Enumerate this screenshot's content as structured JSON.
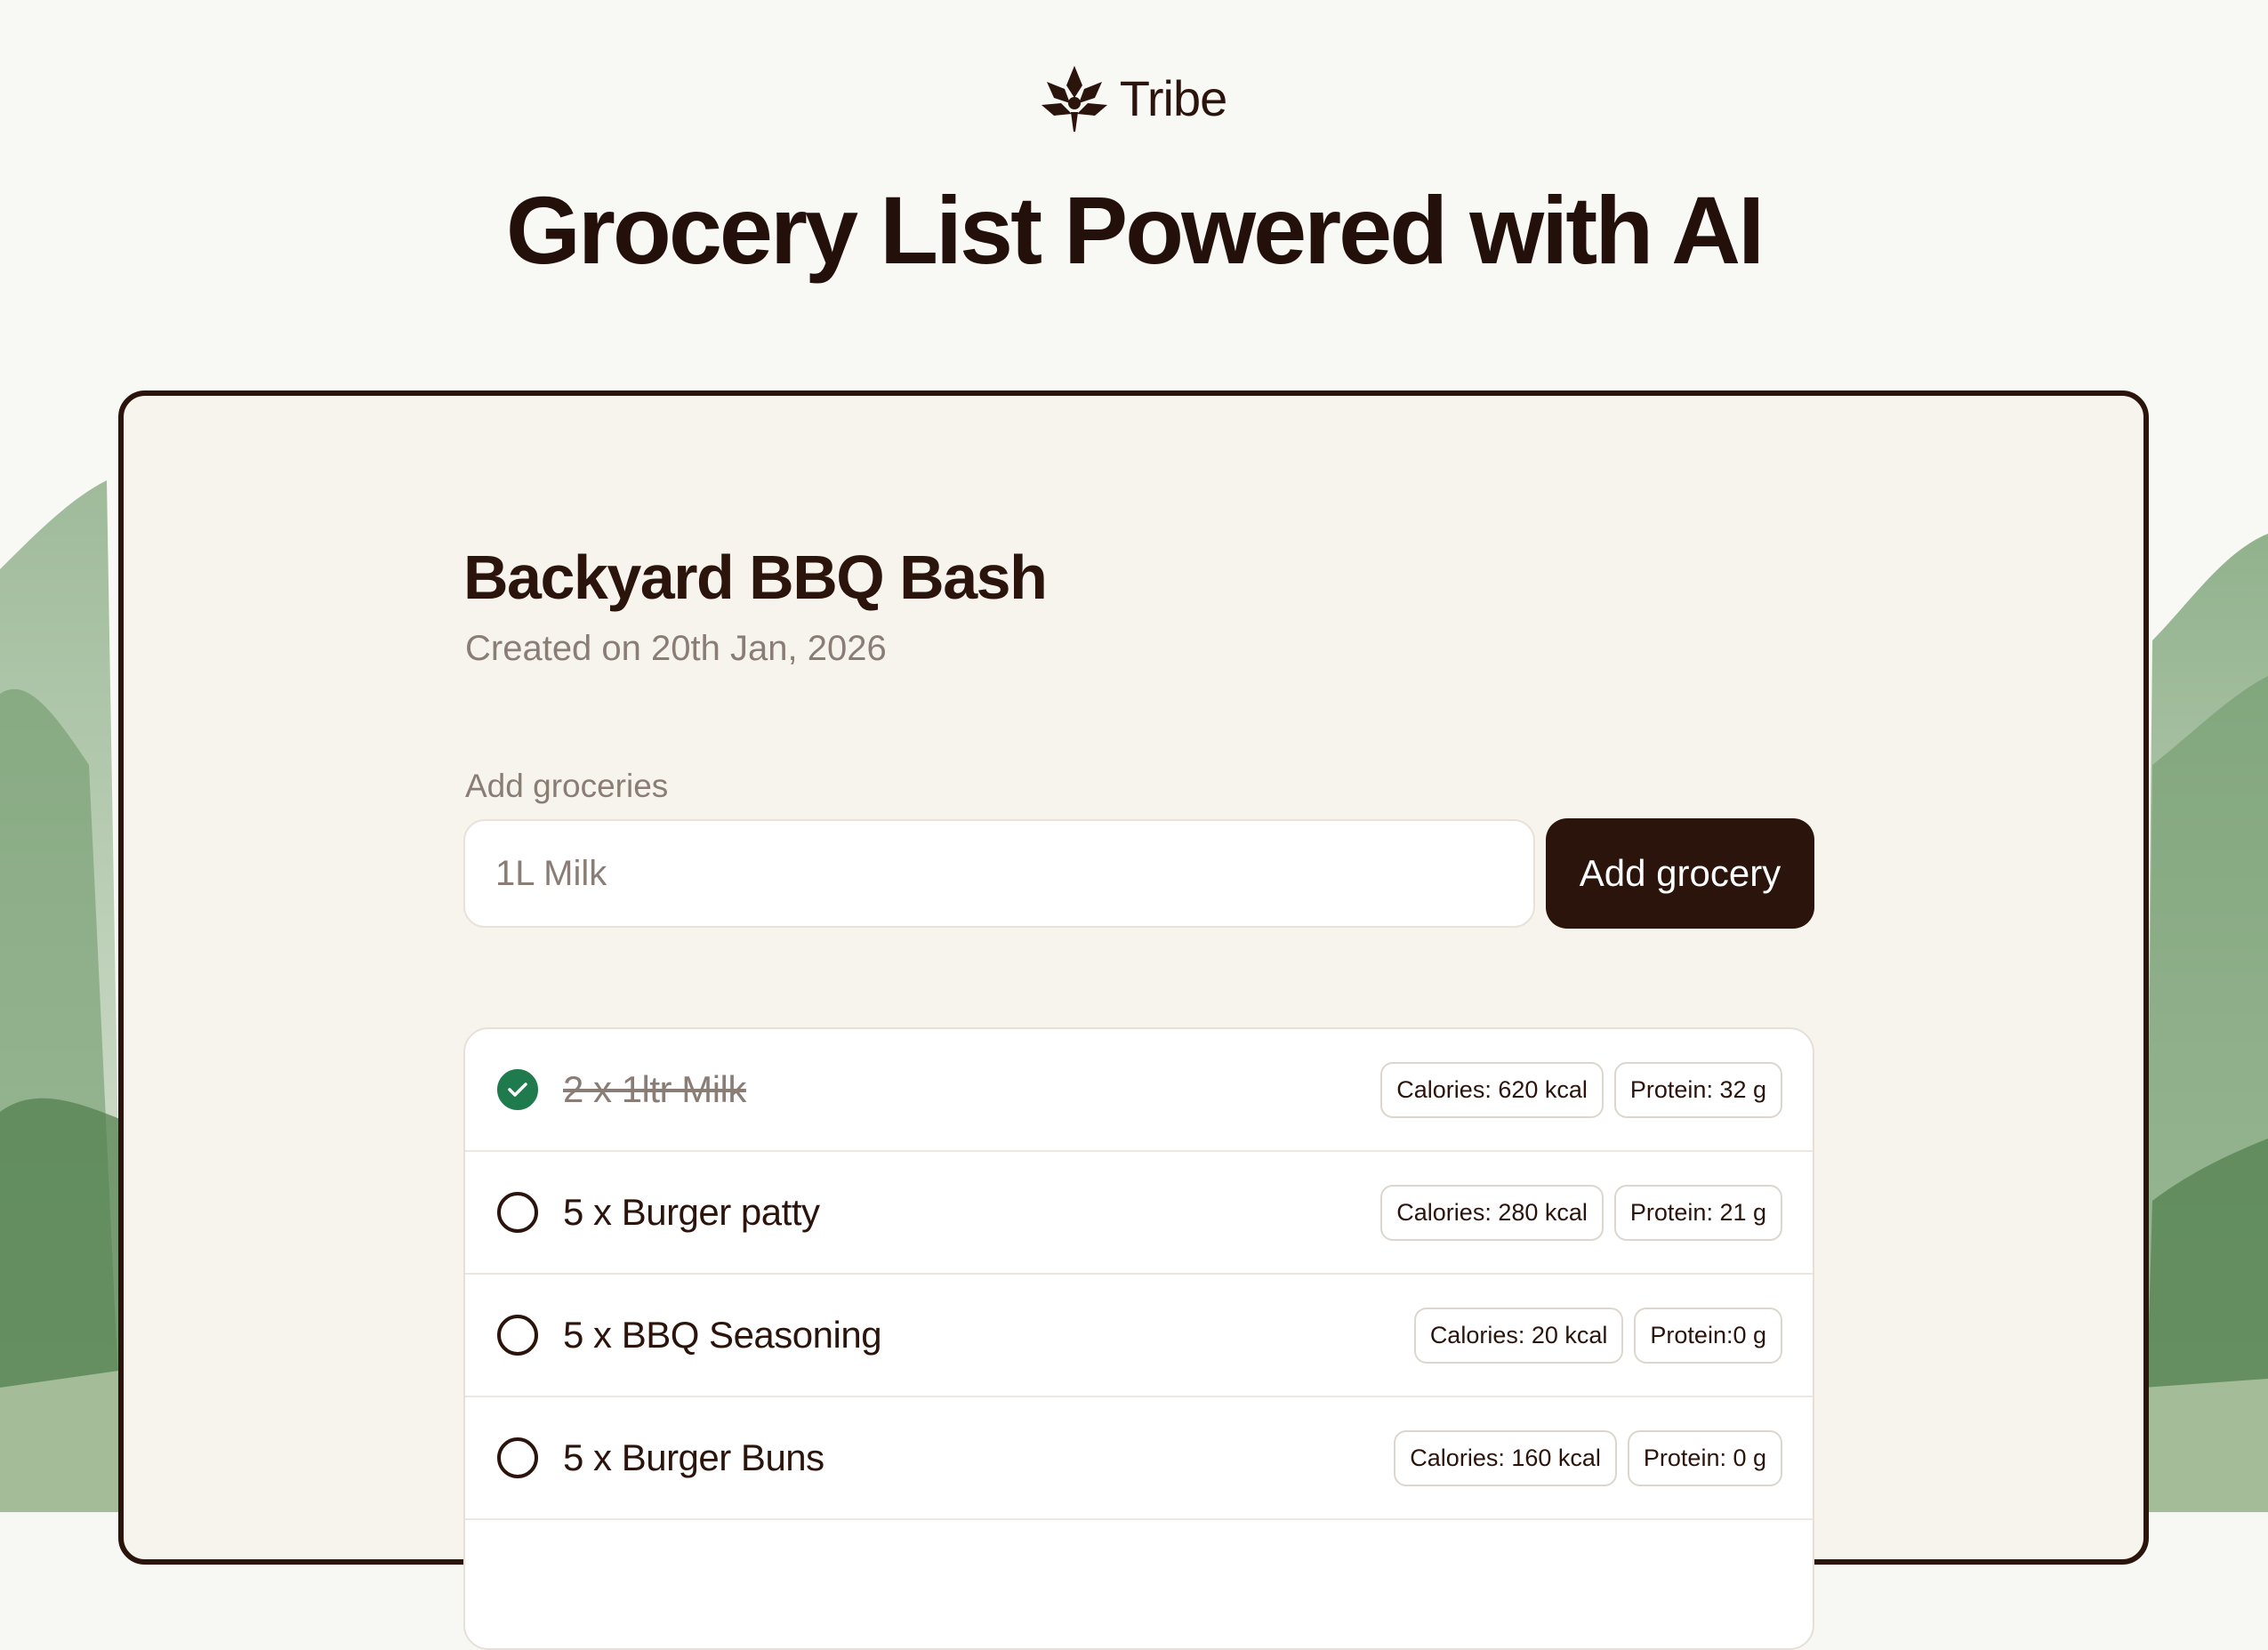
{
  "brand": {
    "name": "Tribe",
    "icon": "lotus-logo-icon"
  },
  "headline": "Grocery List Powered with AI",
  "list": {
    "title": "Backyard BBQ Bash",
    "created": "Created on 20th Jan, 2026"
  },
  "add_section": {
    "label": "Add groceries",
    "placeholder": "1L Milk",
    "button_label": "Add grocery"
  },
  "items": [
    {
      "label": "2 x 1ltr Milk",
      "checked": true,
      "calories": "Calories: 620 kcal",
      "protein": "Protein: 32 g"
    },
    {
      "label": "5 x Burger patty",
      "checked": false,
      "calories": "Calories: 280 kcal",
      "protein": "Protein: 21 g"
    },
    {
      "label": "5 x BBQ Seasoning",
      "checked": false,
      "calories": "Calories: 20 kcal",
      "protein": "Protein:0 g"
    },
    {
      "label": "5 x Burger Buns",
      "checked": false,
      "calories": "Calories: 160 kcal",
      "protein": "Protein: 0 g"
    }
  ],
  "colors": {
    "brand_dark": "#2a140c",
    "muted_text": "#8a7d75",
    "card_bg": "#f7f4ee",
    "check_green": "#1f7a4d"
  }
}
